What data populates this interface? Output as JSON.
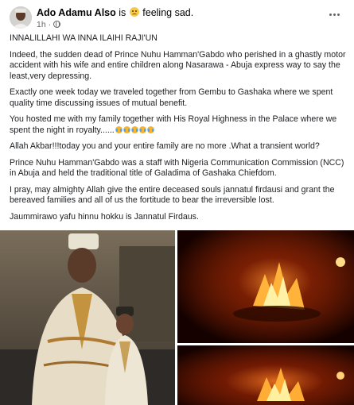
{
  "post": {
    "author_name": "Ado Adamu Also",
    "feeling_prefix": "is",
    "feeling_text": "feeling sad.",
    "feeling_icon": "sad-face-icon",
    "time": "1h",
    "separator": "·",
    "privacy_icon": "globe-icon",
    "menu_icon": "more-options-icon"
  },
  "text": {
    "p1": "INNALILLAHI WA INNA ILAIHI RAJI'UN",
    "p2": "Indeed, the sudden dead of Prince Nuhu Hamman'Gabdo who perished in a ghastly motor accident with his wife and entire children along Nasarawa - Abuja express way to say the least,very depressing.",
    "p3": "Exactly one week today we traveled together from Gembu to Gashaka where we spent quality time discussing issues of mutual benefit.",
    "p4": "You hosted me with my family together with His Royal Highness in the Palace where we spent the night in royalty......",
    "p4_emoji_icon": "crying-face-icon",
    "p5": "Allah Akbar!!!today you and your entire family are no more .What a transient world?",
    "p6": "Prince Nuhu Hamman'Gabdo was a staff with Nigeria Communication Commission (NCC) in Abuja and held the traditional title of Galadima of Gashaka Chiefdom.",
    "p7": "I pray, may almighty Allah give the entire deceased souls jannatul firdausi and grant the bereaved families and all of us  the fortitude to bear the irreversible lost.",
    "p8": "Jaummirawo yafu hinnu hokku is Jannatul Firdaus."
  },
  "photos": {
    "main_alt": "Man in traditional attire with a young boy",
    "fire_1_alt": "Burning vehicle at night",
    "fire_2_alt": "Burning vehicle at night"
  },
  "colors": {
    "secondary_text": "#65676b",
    "fire": "#ff5a1a"
  }
}
